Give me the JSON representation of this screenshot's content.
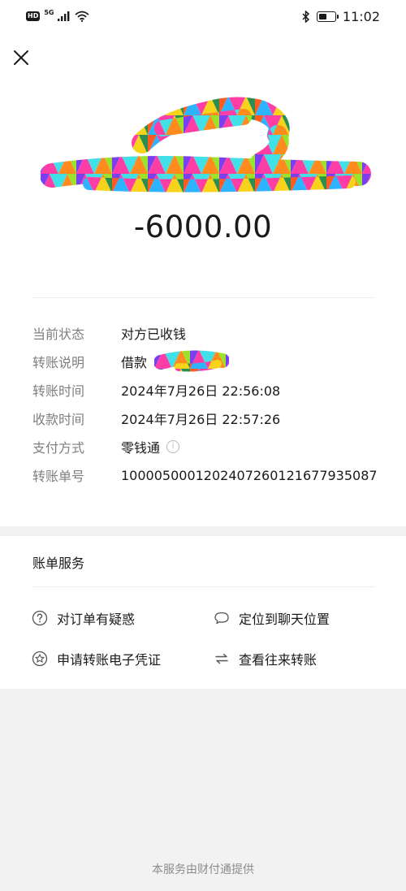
{
  "status_bar": {
    "hd": "HD",
    "network": "5G",
    "time": "11:02",
    "battery_level": 0.6
  },
  "transfer": {
    "amount": "-6000.00",
    "note_visible_prefix": "借款"
  },
  "details": [
    {
      "label": "当前状态",
      "value": "对方已收钱"
    },
    {
      "label": "转账说明",
      "value": "借款"
    },
    {
      "label": "转账时间",
      "value": "2024年7月26日 22:56:08"
    },
    {
      "label": "收款时间",
      "value": "2024年7月26日 22:57:26"
    },
    {
      "label": "支付方式",
      "value": "零钱通"
    },
    {
      "label": "转账单号",
      "value": "1000050001202407260121677935087"
    }
  ],
  "services": {
    "title": "账单服务",
    "items": [
      {
        "label": "对订单有疑惑",
        "icon": "question-circle-icon"
      },
      {
        "label": "定位到聊天位置",
        "icon": "chat-bubble-icon"
      },
      {
        "label": "申请转账电子凭证",
        "icon": "star-badge-icon"
      },
      {
        "label": "查看往来转账",
        "icon": "exchange-arrows-icon"
      }
    ]
  },
  "footer": {
    "text": "本服务由财付通提供"
  },
  "colors": {
    "text": "#1a1a1a",
    "label": "#7f7f7f",
    "background": "#f2f2f2",
    "card": "#ffffff"
  }
}
